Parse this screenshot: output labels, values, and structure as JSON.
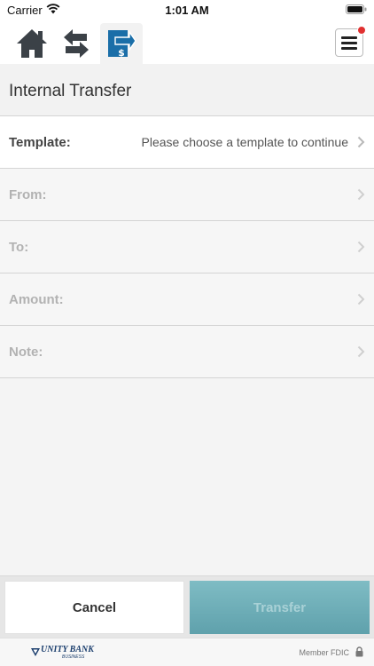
{
  "status_bar": {
    "carrier": "Carrier",
    "time": "1:01 AM"
  },
  "nav": {
    "icons": [
      "home-icon",
      "transfer-arrows-icon",
      "internal-transfer-icon",
      "hamburger-menu-icon"
    ],
    "active_tab": "internal-transfer",
    "notification_dot_color": "#e03030"
  },
  "page": {
    "title": "Internal Transfer"
  },
  "form": {
    "template": {
      "label": "Template:",
      "value": "Please choose a template to continue"
    },
    "from": {
      "label": "From:"
    },
    "to": {
      "label": "To:"
    },
    "amount": {
      "label": "Amount:"
    },
    "note": {
      "label": "Note:"
    }
  },
  "actions": {
    "cancel_label": "Cancel",
    "transfer_label": "Transfer",
    "transfer_color": "#6eb0ba"
  },
  "footer": {
    "logo_name": "UNITY BANK",
    "logo_sub": "BUSINESS",
    "member_text": "Member FDIC"
  }
}
